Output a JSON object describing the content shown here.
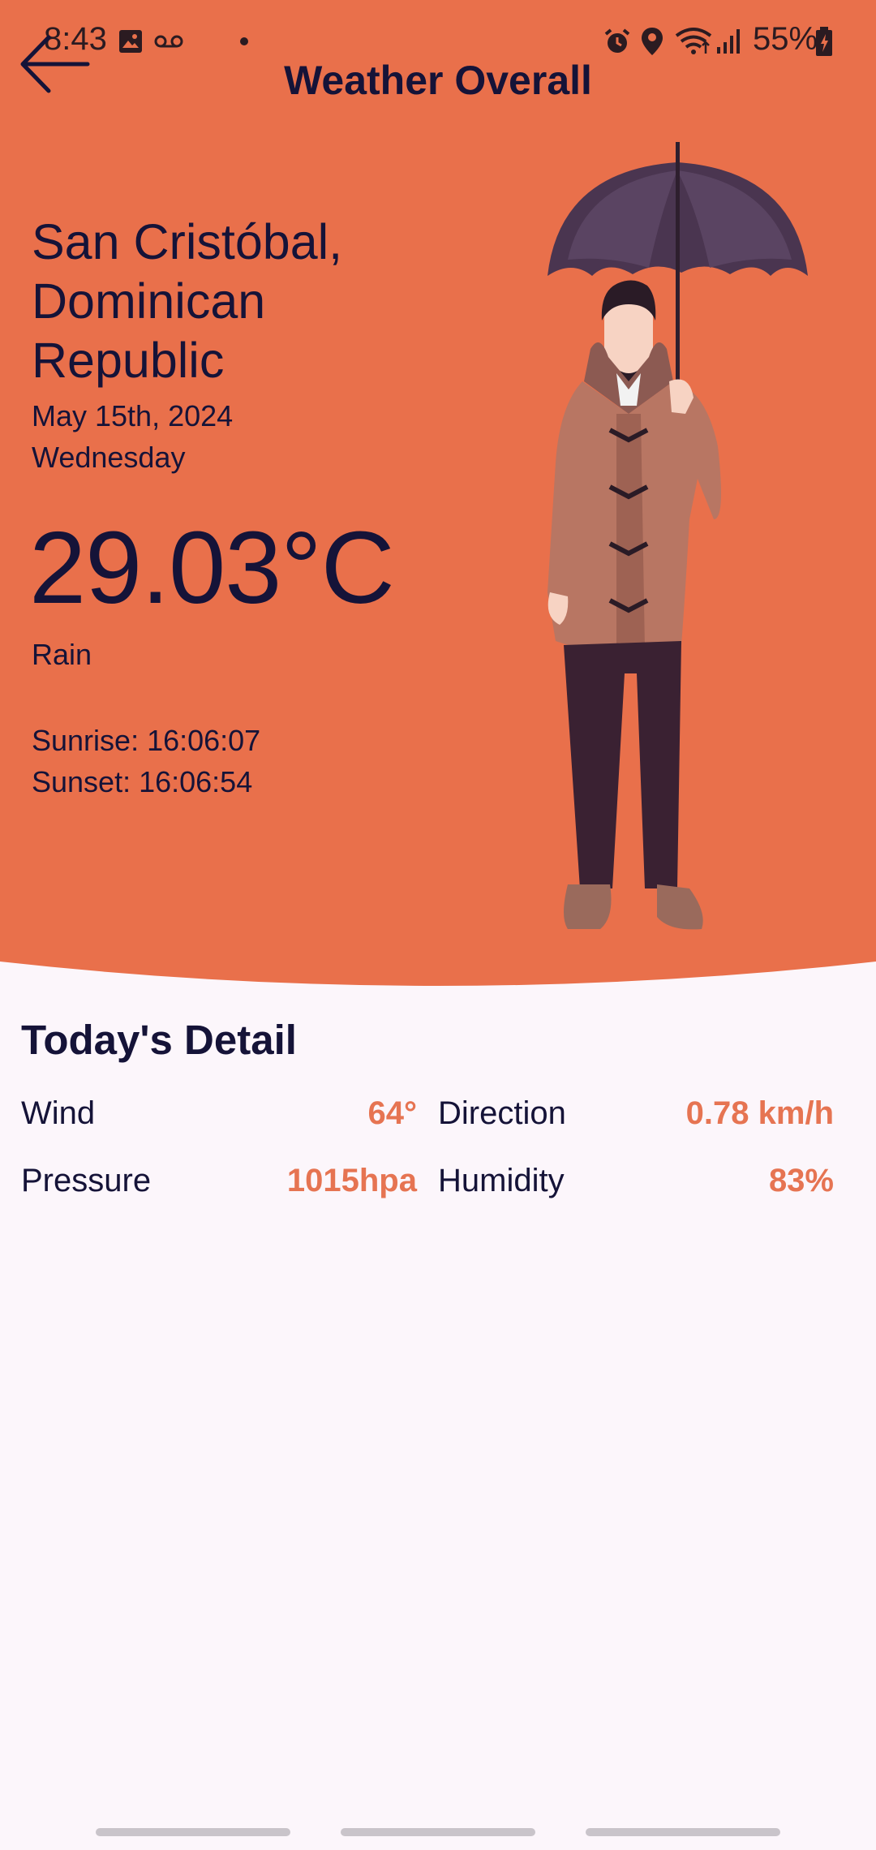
{
  "colors": {
    "hero_bg": "#E9704B",
    "page_bg": "#FCF6FB",
    "text_primary": "#151338",
    "accent_value": "#E67452"
  },
  "status_bar": {
    "time": "8:43",
    "battery": "55%",
    "icons": [
      "image-icon",
      "voicemail-icon",
      "dot-icon",
      "alarm-icon",
      "location-icon",
      "wifi-icon",
      "signal-icon",
      "battery-icon"
    ]
  },
  "app_bar": {
    "title": "Weather Overall",
    "back_icon": "arrow-left-icon"
  },
  "weather": {
    "location_line1": "San Cristóbal,",
    "location_line2": "Dominican",
    "location_line3": "Republic",
    "date": "May 15th, 2024",
    "weekday": "Wednesday",
    "temperature": "29.03°C",
    "condition": "Rain",
    "sunrise": "Sunrise: 16:06:07",
    "sunset": "Sunset: 16:06:54",
    "illustration": "man-with-umbrella"
  },
  "details": {
    "title": "Today's Detail",
    "items": [
      {
        "label": "Wind",
        "value": "64°"
      },
      {
        "label": "Direction",
        "value": "0.78 km/h"
      },
      {
        "label": "Pressure",
        "value": "1015hpa"
      },
      {
        "label": "Humidity",
        "value": "83%"
      }
    ]
  }
}
